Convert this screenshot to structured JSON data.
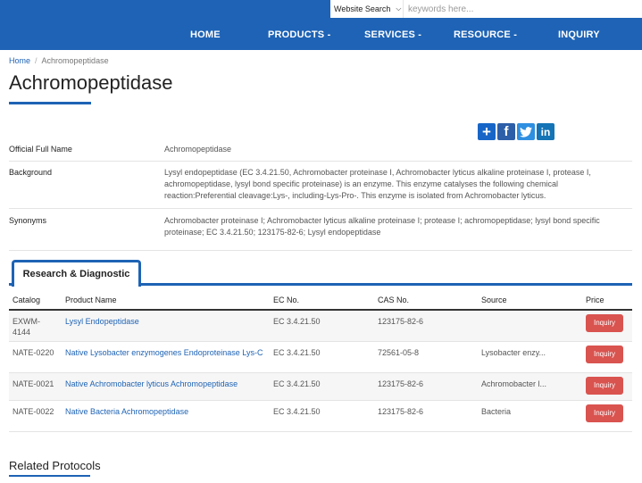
{
  "search": {
    "scope": "Website Search",
    "placeholder": "keywords here..."
  },
  "nav": {
    "items": [
      {
        "label": "HOME"
      },
      {
        "label": "PRODUCTS -"
      },
      {
        "label": "SERVICES -"
      },
      {
        "label": "RESOURCE -"
      },
      {
        "label": "INQUIRY"
      }
    ]
  },
  "breadcrumb": {
    "home": "Home",
    "separator": "/",
    "current": "Achromopeptidase"
  },
  "page": {
    "title": "Achromopeptidase"
  },
  "share": {
    "icons": [
      "plus-icon",
      "facebook-icon",
      "twitter-icon",
      "linkedin-icon"
    ],
    "facebook_glyph": "f",
    "linkedin_glyph": "in",
    "plus_glyph": "+"
  },
  "info": [
    {
      "label": "Official Full Name",
      "value": "Achromopeptidase"
    },
    {
      "label": "Background",
      "value": "Lysyl endopeptidase (EC 3.4.21.50, Achromobacter proteinase I, Achromobacter lyticus alkaline proteinase I, protease I, achromopeptidase, lysyl bond specific proteinase) is an enzyme. This enzyme catalyses the following chemical reaction:Preferential cleavage:Lys-, including-Lys-Pro-. This enzyme is isolated from Achromobacter lyticus."
    },
    {
      "label": "Synonyms",
      "value": "Achromobacter proteinase I; Achromobacter lyticus alkaline proteinase I; protease I; achromopeptidase; lysyl bond specific proteinase; EC 3.4.21.50; 123175-82-6; Lysyl endopeptidase"
    }
  ],
  "tabs": {
    "active": "Research & Diagnostic"
  },
  "table": {
    "headers": [
      "Catalog",
      "Product Name",
      "EC No.",
      "CAS No.",
      "Source",
      "Price"
    ],
    "rows": [
      {
        "catalog": "EXWM-4144",
        "name": "Lysyl Endopeptidase",
        "ec": "EC 3.4.21.50",
        "cas": "123175-82-6",
        "source": "",
        "price": "Inquiry"
      },
      {
        "catalog": "NATE-0220",
        "name": "Native Lysobacter enzymogenes Endoproteinase Lys-C",
        "ec": "EC 3.4.21.50",
        "cas": "72561-05-8",
        "source": "Lysobacter enzy...",
        "price": "Inquiry"
      },
      {
        "catalog": "NATE-0021",
        "name": "Native Achromobacter lyticus Achromopeptidase",
        "ec": "EC 3.4.21.50",
        "cas": "123175-82-6",
        "source": "Achromobacter l...",
        "price": "Inquiry"
      },
      {
        "catalog": "NATE-0022",
        "name": "Native Bacteria Achromopeptidase",
        "ec": "EC 3.4.21.50",
        "cas": "123175-82-6",
        "source": "Bacteria",
        "price": "Inquiry"
      }
    ]
  },
  "related": {
    "title": "Related Protocols"
  },
  "colors": {
    "brand": "#1e63b5",
    "inquiry_button": "#d9534f"
  }
}
